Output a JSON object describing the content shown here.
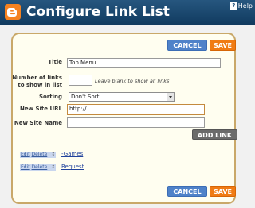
{
  "header": {
    "title": "Configure Link List",
    "help_label": "Help"
  },
  "buttons": {
    "cancel": "CANCEL",
    "save": "SAVE",
    "add_link": "ADD LINK"
  },
  "form": {
    "title_label": "Title",
    "title_value": "Top Menu",
    "count_label_line1": "Number of links",
    "count_label_line2": "to show in list",
    "count_value": "",
    "count_hint": "Leave blank to show all links",
    "sorting_label": "Sorting",
    "sorting_value": "Don't Sort",
    "url_label": "New Site URL",
    "url_value": "http://",
    "name_label": "New Site Name",
    "name_value": ""
  },
  "links": [
    {
      "edit": "Edit",
      "delete": "Delete",
      "sort": "↕",
      "name": "-Games"
    },
    {
      "edit": "Edit",
      "delete": "Delete",
      "sort": "↕",
      "name": "Request"
    }
  ],
  "colors": {
    "header_bg": "#1f4e78",
    "panel_bg": "#fffef0",
    "panel_border": "#c9a869",
    "cancel_blue": "#4f82c9",
    "save_orange": "#f07b14",
    "add_gray": "#6b6b6b"
  },
  "icons": {
    "logo": "blogger-logo-icon",
    "help": "help-icon",
    "select": "chevron-down-icon"
  }
}
